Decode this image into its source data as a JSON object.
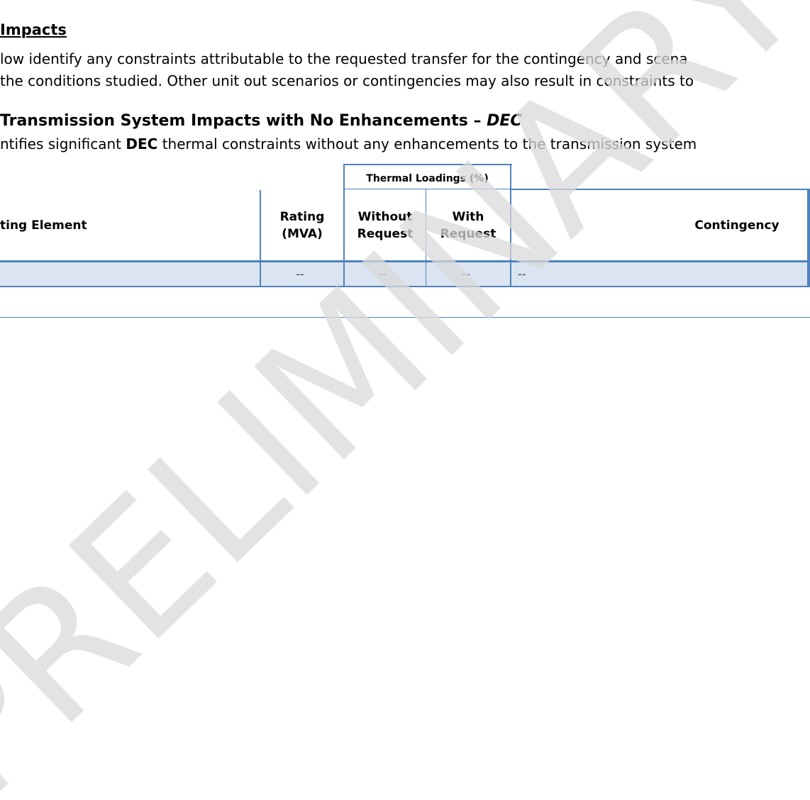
{
  "heading": {
    "title": " Impacts",
    "para_line1": "low identify any constraints attributable to the requested transfer for the contingency and scena",
    "para_line2": "the conditions studied. Other unit out scenarios or contingencies may also result in constraints to"
  },
  "subsection": {
    "title_main": " Transmission System Impacts with No Enhancements – ",
    "title_tag": "DEC",
    "desc_pre": "ntifies significant ",
    "desc_bold": "DEC",
    "desc_post": " thermal constraints without any enhancements to the transmission system"
  },
  "table": {
    "group_header": "Thermal Loadings (%)",
    "columns": {
      "element": "ting Element",
      "rating_line1": "Rating",
      "rating_line2": "(MVA)",
      "without_line1": "Without",
      "without_line2": "Request",
      "with_line1": "With",
      "with_line2": "Request",
      "contingency": "Contingency"
    },
    "rows": [
      {
        "element": "",
        "rating": "--",
        "without": "--",
        "with": "--",
        "contingency": "--"
      }
    ]
  },
  "watermark": {
    "text": "PRELIMINARY",
    "color": "#d9d9d9"
  },
  "colors": {
    "table_border": "#4f81bd",
    "row_fill": "#dbe5f1"
  }
}
